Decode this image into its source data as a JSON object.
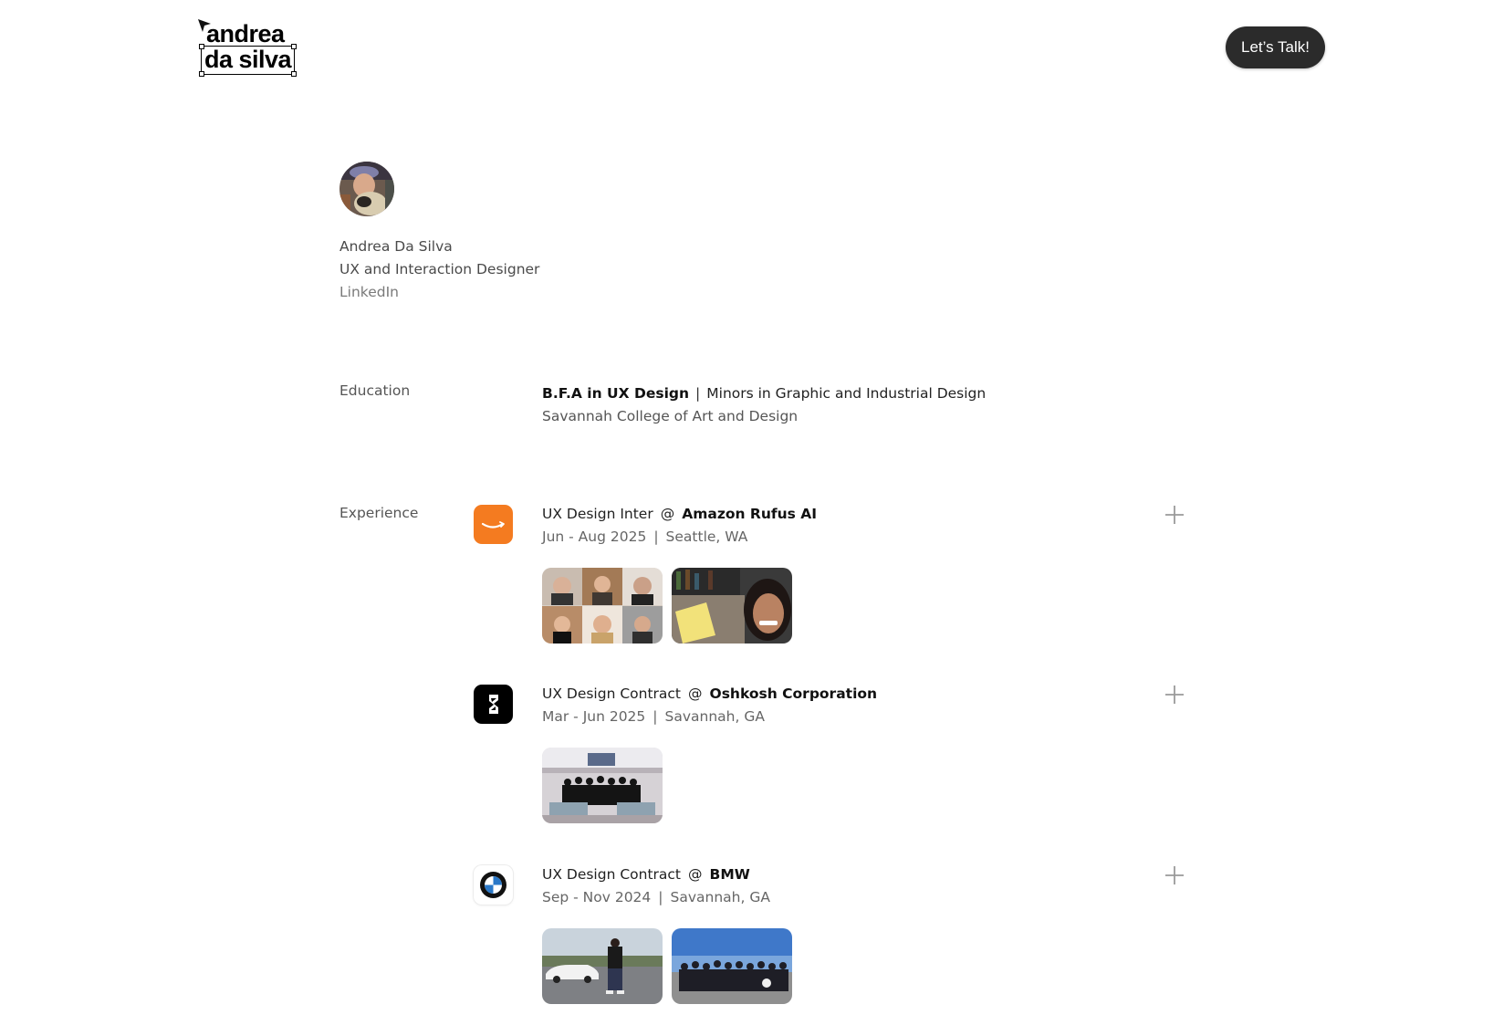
{
  "header": {
    "logo_line1": "andrea",
    "logo_line2": "da silva",
    "cta_label": "Let’s Talk!"
  },
  "profile": {
    "name": "Andrea Da Silva",
    "role": "UX and Interaction Designer",
    "link_label": "LinkedIn"
  },
  "education": {
    "label": "Education",
    "degree": "B.F.A in UX Design",
    "separator": "|",
    "minors": "Minors in Graphic and Industrial Design",
    "school": "Savannah College of Art and Design"
  },
  "experience": {
    "label": "Experience",
    "jobs": [
      {
        "title": "UX Design Inter",
        "at": "@",
        "company": "Amazon Rufus AI",
        "dates": "Jun - Aug 2025",
        "separator": "|",
        "location": "Seattle, WA",
        "logo_icon": "amazon-smile-icon",
        "logo_color": "#F47B20"
      },
      {
        "title": "UX Design Contract",
        "at": "@",
        "company": "Oshkosh Corporation",
        "dates": "Mar - Jun 2025",
        "separator": "|",
        "location": "Savannah, GA",
        "logo_icon": "oshkosh-icon",
        "logo_color": "#000000"
      },
      {
        "title": "UX Design Contract",
        "at": "@",
        "company": "BMW",
        "dates": "Sep - Nov 2024",
        "separator": "|",
        "location": "Savannah, GA",
        "logo_icon": "bmw-roundel-icon",
        "logo_color": "#FFFFFF"
      }
    ]
  },
  "colors": {
    "cta_background": "#2B2B2B",
    "text_primary": "#111111",
    "text_secondary": "#555555",
    "page_background": "#FFFFFF"
  }
}
